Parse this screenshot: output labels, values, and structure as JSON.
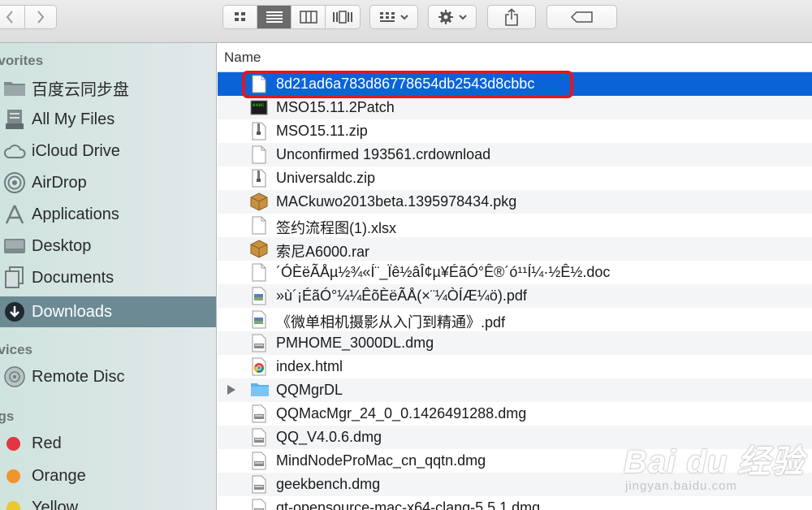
{
  "sidebar": {
    "favorites_header": "avorites",
    "devices_header": "evices",
    "tags_header": "ags",
    "items": [
      {
        "label": "百度云同步盘",
        "icon": "folder-icon"
      },
      {
        "label": "All My Files",
        "icon": "all-files-icon"
      },
      {
        "label": "iCloud Drive",
        "icon": "cloud-icon"
      },
      {
        "label": "AirDrop",
        "icon": "airdrop-icon"
      },
      {
        "label": "Applications",
        "icon": "applications-icon"
      },
      {
        "label": "Desktop",
        "icon": "desktop-icon"
      },
      {
        "label": "Documents",
        "icon": "documents-icon"
      },
      {
        "label": "Downloads",
        "icon": "downloads-icon",
        "selected": true
      }
    ],
    "devices": [
      {
        "label": "Remote Disc",
        "icon": "disc-icon"
      }
    ],
    "tags": [
      {
        "label": "Red",
        "color": "#e0383e"
      },
      {
        "label": "Orange",
        "color": "#f0952c"
      },
      {
        "label": "Yellow",
        "color": "#e8c930"
      }
    ]
  },
  "list": {
    "column_name": "Name",
    "files": [
      {
        "name": "8d21ad6a783d86778654db2543d8cbbc",
        "icon": "blank-doc-icon",
        "selected": true
      },
      {
        "name": "MSO15.11.2Patch",
        "icon": "terminal-icon"
      },
      {
        "name": "MSO15.11.zip",
        "icon": "zip-icon"
      },
      {
        "name": "Unconfirmed 193561.crdownload",
        "icon": "blank-doc-icon"
      },
      {
        "name": "Universaldc.zip",
        "icon": "zip-icon"
      },
      {
        "name": "MACkuwo2013beta.1395978434.pkg",
        "icon": "package-icon"
      },
      {
        "name": "签约流程图(1).xlsx",
        "icon": "blank-doc-icon"
      },
      {
        "name": "索尼A6000.rar",
        "icon": "package-icon"
      },
      {
        "name": "´ÓÈëÃÅµ½¾«Í¨_Ïê½âÎ¢µ¥ÉãÓ°Ê®´ó¹¹Í¼·½Ê½.doc",
        "icon": "blank-doc-icon"
      },
      {
        "name": "»ù´¡ÉãÓ°¼¼ÊõÈëÃÅ(×¨¼ÒÍÆ¼ö).pdf",
        "icon": "pdf-icon"
      },
      {
        "name": "《微单相机摄影从入门到精通》.pdf",
        "icon": "pdf-icon"
      },
      {
        "name": "PMHOME_3000DL.dmg",
        "icon": "dmg-icon"
      },
      {
        "name": "index.html",
        "icon": "chrome-html-icon"
      },
      {
        "name": "QQMgrDL",
        "icon": "folder-icon",
        "folder": true
      },
      {
        "name": "QQMacMgr_24_0_0.1426491288.dmg",
        "icon": "dmg-icon"
      },
      {
        "name": "QQ_V4.0.6.dmg",
        "icon": "dmg-icon"
      },
      {
        "name": "MindNodeProMac_cn_qqtn.dmg",
        "icon": "dmg-icon"
      },
      {
        "name": "geekbench.dmg",
        "icon": "dmg-icon"
      },
      {
        "name": "qt-opensource-mac-x64-clang-5.5.1.dmg",
        "icon": "dmg-icon"
      }
    ]
  },
  "watermark": {
    "main": "Bai du 经验",
    "sub": "jingyan.baidu.com"
  },
  "colors": {
    "selection": "#0a64d8",
    "sidebar_selected": "#6c8a94",
    "highlight_box": "#e8141e"
  }
}
